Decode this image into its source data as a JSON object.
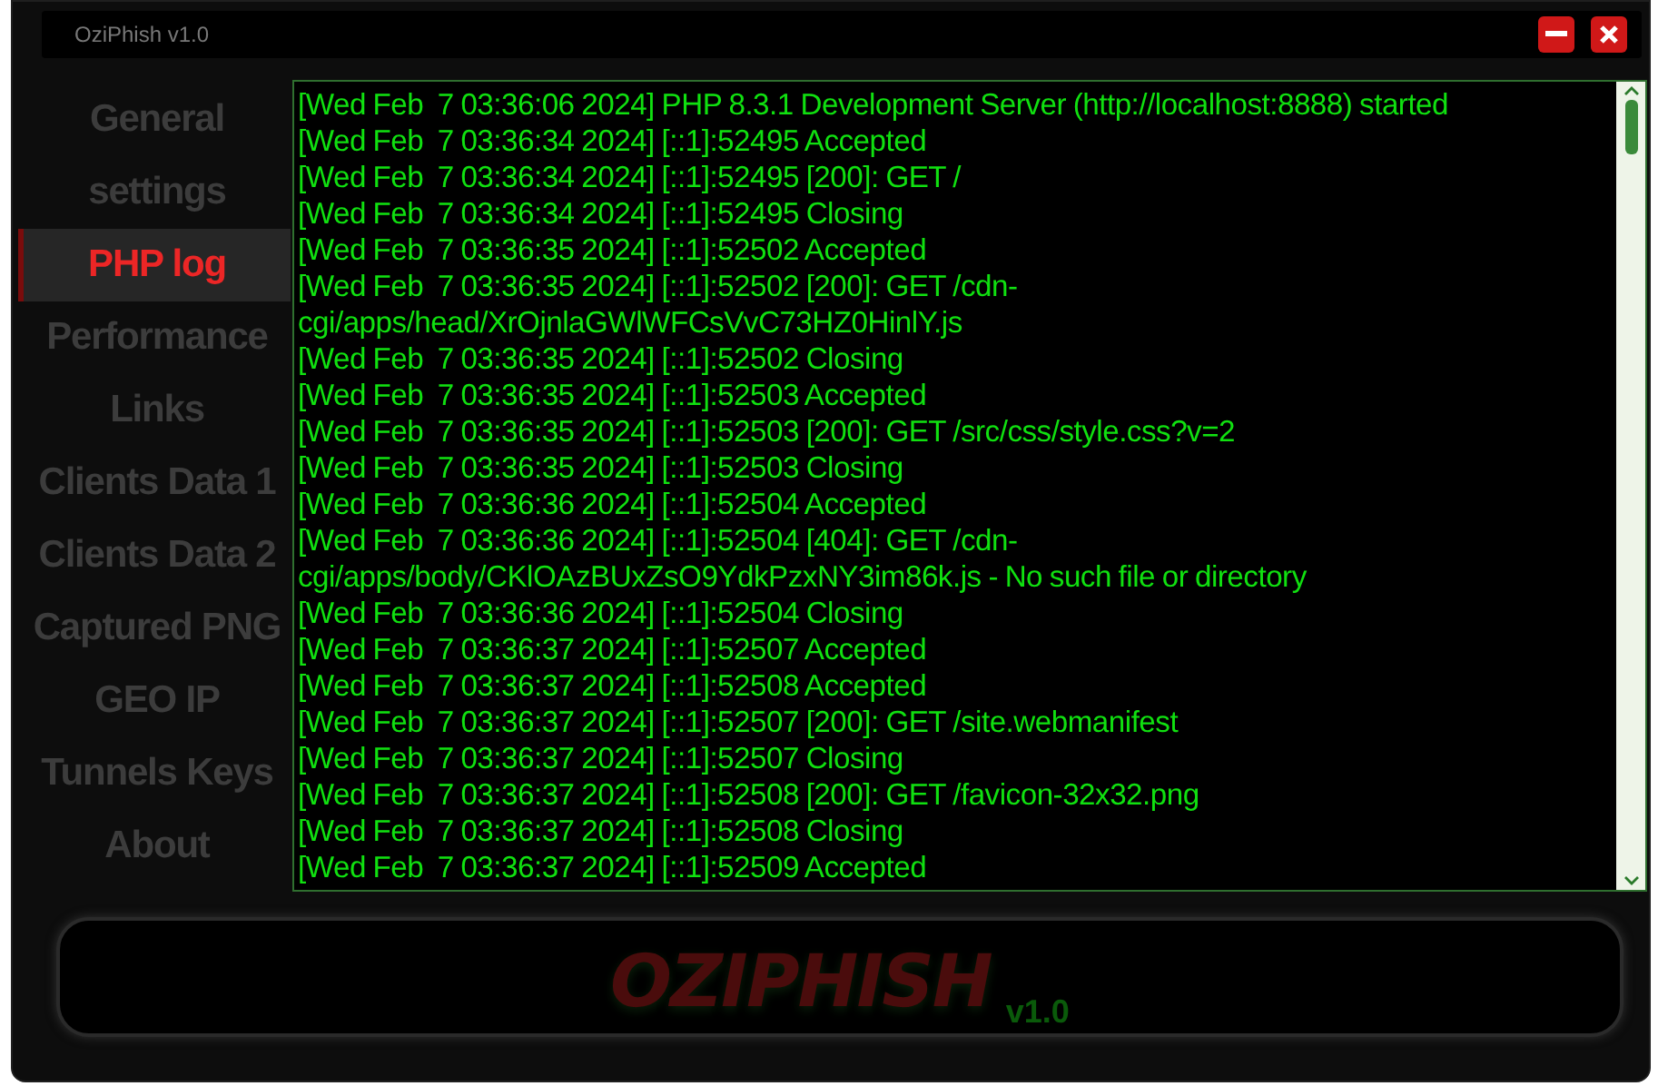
{
  "window": {
    "title": "OziPhish v1.0"
  },
  "sidebar": {
    "items": [
      {
        "label": "General settings",
        "selected": false
      },
      {
        "label": "PHP log",
        "selected": true
      },
      {
        "label": "Performance",
        "selected": false
      },
      {
        "label": "Links",
        "selected": false
      },
      {
        "label": "Clients Data 1",
        "selected": false
      },
      {
        "label": "Clients Data 2",
        "selected": false
      },
      {
        "label": "Captured PNG",
        "selected": false
      },
      {
        "label": "GEO IP",
        "selected": false
      },
      {
        "label": "Tunnels Keys",
        "selected": false
      },
      {
        "label": "About",
        "selected": false
      }
    ]
  },
  "log": {
    "lines": [
      "[Wed Feb  7 03:36:06 2024] PHP 8.3.1 Development Server (http://localhost:8888) started",
      "[Wed Feb  7 03:36:34 2024] [::1]:52495 Accepted",
      "[Wed Feb  7 03:36:34 2024] [::1]:52495 [200]: GET /",
      "[Wed Feb  7 03:36:34 2024] [::1]:52495 Closing",
      "[Wed Feb  7 03:36:35 2024] [::1]:52502 Accepted",
      "[Wed Feb  7 03:36:35 2024] [::1]:52502 [200]: GET /cdn-cgi/apps/head/XrOjnlaGWlWFCsVvC73HZ0HinlY.js",
      "[Wed Feb  7 03:36:35 2024] [::1]:52502 Closing",
      "[Wed Feb  7 03:36:35 2024] [::1]:52503 Accepted",
      "[Wed Feb  7 03:36:35 2024] [::1]:52503 [200]: GET /src/css/style.css?v=2",
      "[Wed Feb  7 03:36:35 2024] [::1]:52503 Closing",
      "[Wed Feb  7 03:36:36 2024] [::1]:52504 Accepted",
      "[Wed Feb  7 03:36:36 2024] [::1]:52504 [404]: GET /cdn-cgi/apps/body/CKlOAzBUxZsO9YdkPzxNY3im86k.js - No such file or directory",
      "[Wed Feb  7 03:36:36 2024] [::1]:52504 Closing",
      "[Wed Feb  7 03:36:37 2024] [::1]:52507 Accepted",
      "[Wed Feb  7 03:36:37 2024] [::1]:52508 Accepted",
      "[Wed Feb  7 03:36:37 2024] [::1]:52507 [200]: GET /site.webmanifest",
      "[Wed Feb  7 03:36:37 2024] [::1]:52507 Closing",
      "[Wed Feb  7 03:36:37 2024] [::1]:52508 [200]: GET /favicon-32x32.png",
      "[Wed Feb  7 03:36:37 2024] [::1]:52508 Closing",
      "[Wed Feb  7 03:36:37 2024] [::1]:52509 Accepted"
    ]
  },
  "footer": {
    "logo": "OZIPHISH",
    "version": "v1.0"
  }
}
